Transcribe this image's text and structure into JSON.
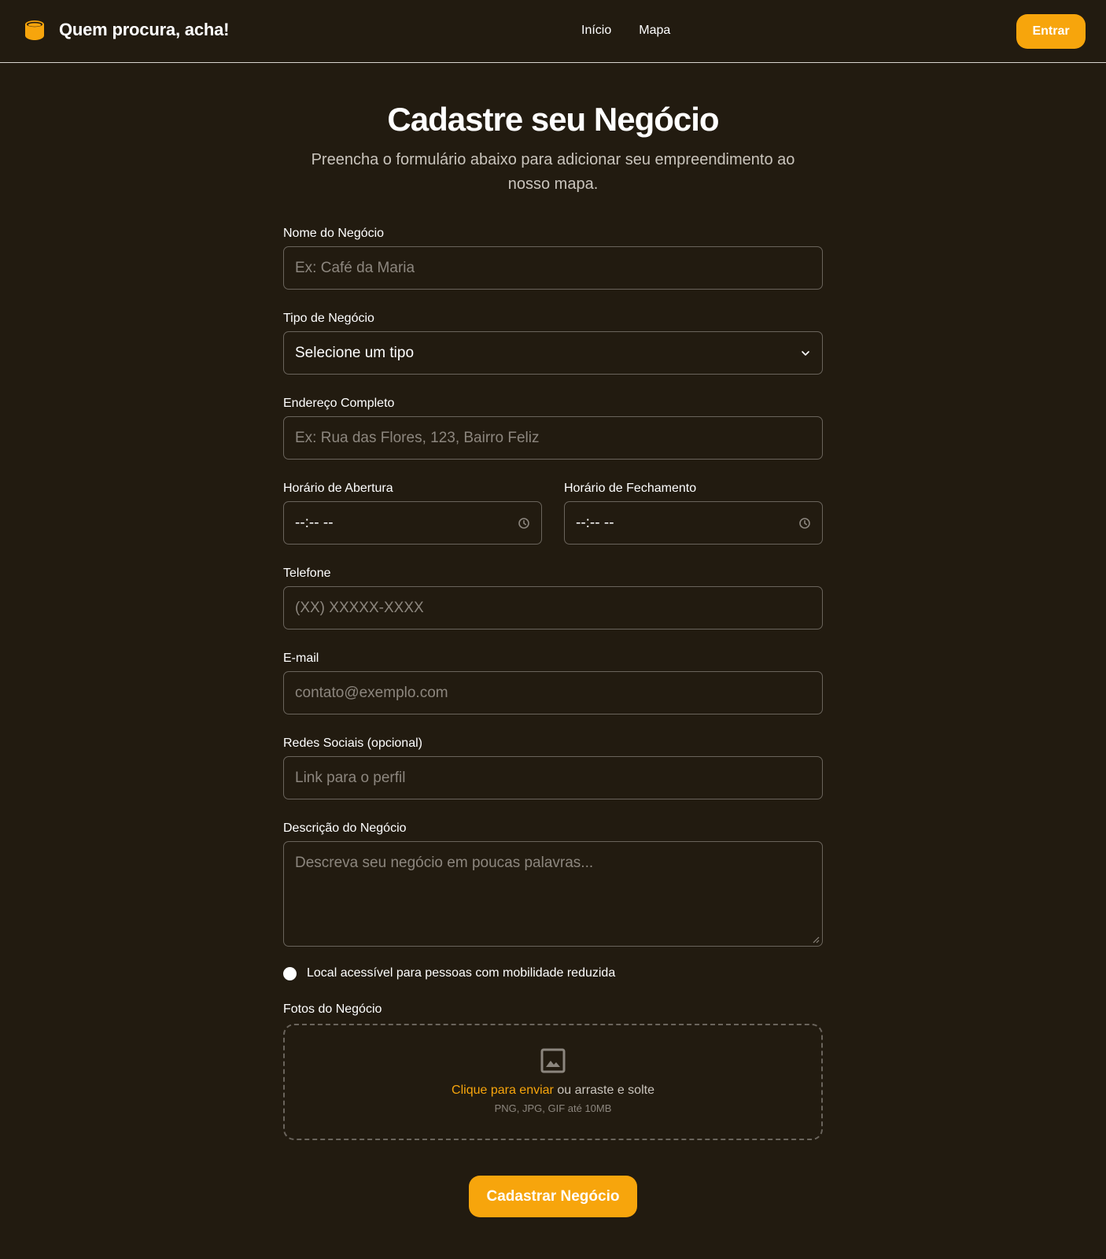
{
  "header": {
    "brand_title": "Quem procura, acha!",
    "brand_icon": "cylinder-icon",
    "nav": [
      "Início",
      "Mapa"
    ],
    "login_label": "Entrar"
  },
  "colors": {
    "background": "#221b10",
    "accent": "#f7a50c",
    "border": "#6a645c"
  },
  "page": {
    "title": "Cadastre seu Negócio",
    "subtitle": "Preencha o formulário abaixo para adicionar seu empreendimento ao nosso mapa."
  },
  "form": {
    "name": {
      "label": "Nome do Negócio",
      "placeholder": "Ex: Café da Maria"
    },
    "type": {
      "label": "Tipo de Negócio",
      "value": "Selecione um tipo"
    },
    "address": {
      "label": "Endereço Completo",
      "placeholder": "Ex: Rua das Flores, 123, Bairro Feliz"
    },
    "open_time": {
      "label": "Horário de Abertura",
      "value": "--:-- --"
    },
    "close_time": {
      "label": "Horário de Fechamento",
      "value": "--:-- --"
    },
    "phone": {
      "label": "Telefone",
      "placeholder": "(XX) XXXXX-XXXX"
    },
    "email": {
      "label": "E-mail",
      "placeholder": "contato@exemplo.com"
    },
    "social": {
      "label": "Redes Sociais (opcional)",
      "placeholder": "Link para o perfil"
    },
    "description": {
      "label": "Descrição do Negócio",
      "placeholder": "Descreva seu negócio em poucas palavras..."
    },
    "accessible": {
      "label": "Local acessível para pessoas com mobilidade reduzida",
      "checked": false
    },
    "photos": {
      "label": "Fotos do Negócio",
      "upload_link": "Clique para enviar",
      "upload_text": "ou arraste e solte",
      "hint": "PNG, JPG, GIF até 10MB"
    },
    "submit_label": "Cadastrar Negócio"
  }
}
